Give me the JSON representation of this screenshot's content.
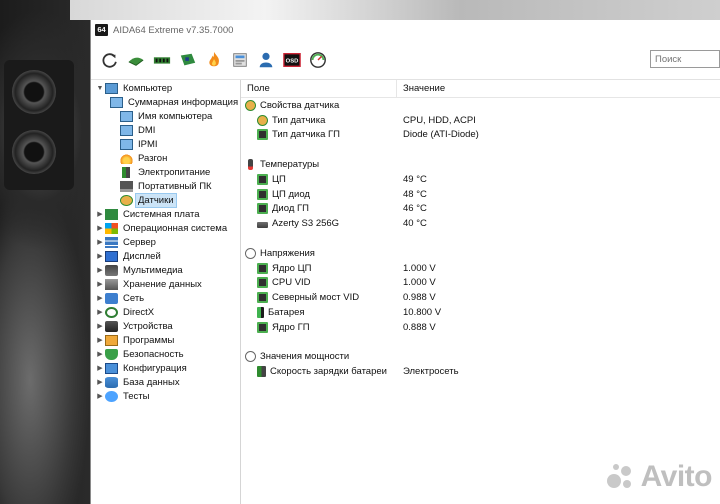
{
  "window": {
    "title": "AIDA64 Extreme v7.35.7000",
    "app_icon": "64"
  },
  "toolbar": {
    "icons": [
      "refresh-icon",
      "report-icon",
      "memory-icon",
      "motherboard-icon",
      "flame-icon",
      "network-icon",
      "user-icon",
      "osd-icon",
      "gauge-icon"
    ],
    "osd_label": "OSD",
    "search_placeholder": "Поиск"
  },
  "tree": [
    {
      "label": "Компьютер",
      "level": 0,
      "expanded": true,
      "icon": "computer-icon"
    },
    {
      "label": "Суммарная информация",
      "level": 1,
      "icon": "monitor-icon"
    },
    {
      "label": "Имя компьютера",
      "level": 1,
      "icon": "monitor-icon"
    },
    {
      "label": "DMI",
      "level": 1,
      "icon": "monitor-icon"
    },
    {
      "label": "IPMI",
      "level": 1,
      "icon": "monitor-icon"
    },
    {
      "label": "Разгон",
      "level": 1,
      "icon": "flame-icon"
    },
    {
      "label": "Электропитание",
      "level": 1,
      "icon": "plug-icon"
    },
    {
      "label": "Портативный ПК",
      "level": 1,
      "icon": "laptop-icon"
    },
    {
      "label": "Датчики",
      "level": 1,
      "icon": "sensor-icon",
      "selected": true
    },
    {
      "label": "Системная плата",
      "level": 0,
      "collapsed": true,
      "icon": "motherboard-icon"
    },
    {
      "label": "Операционная система",
      "level": 0,
      "collapsed": true,
      "icon": "windows-icon"
    },
    {
      "label": "Сервер",
      "level": 0,
      "collapsed": true,
      "icon": "server-icon"
    },
    {
      "label": "Дисплей",
      "level": 0,
      "collapsed": true,
      "icon": "display-icon"
    },
    {
      "label": "Мультимедиа",
      "level": 0,
      "collapsed": true,
      "icon": "multimedia-icon"
    },
    {
      "label": "Хранение данных",
      "level": 0,
      "collapsed": true,
      "icon": "storage-icon"
    },
    {
      "label": "Сеть",
      "level": 0,
      "collapsed": true,
      "icon": "network-icon"
    },
    {
      "label": "DirectX",
      "level": 0,
      "collapsed": true,
      "icon": "directx-icon"
    },
    {
      "label": "Устройства",
      "level": 0,
      "collapsed": true,
      "icon": "devices-icon"
    },
    {
      "label": "Программы",
      "level": 0,
      "collapsed": true,
      "icon": "programs-icon"
    },
    {
      "label": "Безопасность",
      "level": 0,
      "collapsed": true,
      "icon": "security-icon"
    },
    {
      "label": "Конфигурация",
      "level": 0,
      "collapsed": true,
      "icon": "config-icon"
    },
    {
      "label": "База данных",
      "level": 0,
      "collapsed": true,
      "icon": "database-icon"
    },
    {
      "label": "Тесты",
      "level": 0,
      "collapsed": true,
      "icon": "tests-icon"
    }
  ],
  "columns": {
    "field": "Поле",
    "value": "Значение"
  },
  "rows": [
    {
      "kind": "group",
      "field": "Свойства датчика",
      "icon": "sensor-icon"
    },
    {
      "kind": "item",
      "field": "Тип датчика",
      "value": "CPU, HDD, ACPI",
      "icon": "sensor-icon"
    },
    {
      "kind": "item",
      "field": "Тип датчика ГП",
      "value": "Diode  (ATI-Diode)",
      "icon": "gpu-icon"
    },
    {
      "kind": "gap"
    },
    {
      "kind": "group",
      "field": "Температуры",
      "icon": "thermometer-icon"
    },
    {
      "kind": "item",
      "field": "ЦП",
      "value": "49 °C",
      "icon": "chip-icon"
    },
    {
      "kind": "item",
      "field": "ЦП диод",
      "value": "48 °C",
      "icon": "chip-icon"
    },
    {
      "kind": "item",
      "field": "Диод ГП",
      "value": "46 °C",
      "icon": "gpu-icon"
    },
    {
      "kind": "item",
      "field": "Azerty S3 256G",
      "value": "40 °C",
      "icon": "drive-icon"
    },
    {
      "kind": "gap"
    },
    {
      "kind": "group",
      "field": "Напряжения",
      "icon": "voltage-icon"
    },
    {
      "kind": "item",
      "field": "Ядро ЦП",
      "value": "1.000 V",
      "icon": "chip-icon"
    },
    {
      "kind": "item",
      "field": "CPU VID",
      "value": "1.000 V",
      "icon": "chip-icon"
    },
    {
      "kind": "item",
      "field": "Северный мост VID",
      "value": "0.988 V",
      "icon": "chip-icon"
    },
    {
      "kind": "item",
      "field": "Батарея",
      "value": "10.800 V",
      "icon": "battery-icon"
    },
    {
      "kind": "item",
      "field": "Ядро ГП",
      "value": "0.888 V",
      "icon": "gpu-icon"
    },
    {
      "kind": "gap"
    },
    {
      "kind": "group",
      "field": "Значения мощности",
      "icon": "voltage-icon"
    },
    {
      "kind": "item",
      "field": "Скорость зарядки батареи",
      "value": "Электросеть",
      "icon": "plug-icon"
    }
  ],
  "watermark": "Avito",
  "colors": {
    "selection": "#cce4f7",
    "accent_green": "#4caf50"
  }
}
